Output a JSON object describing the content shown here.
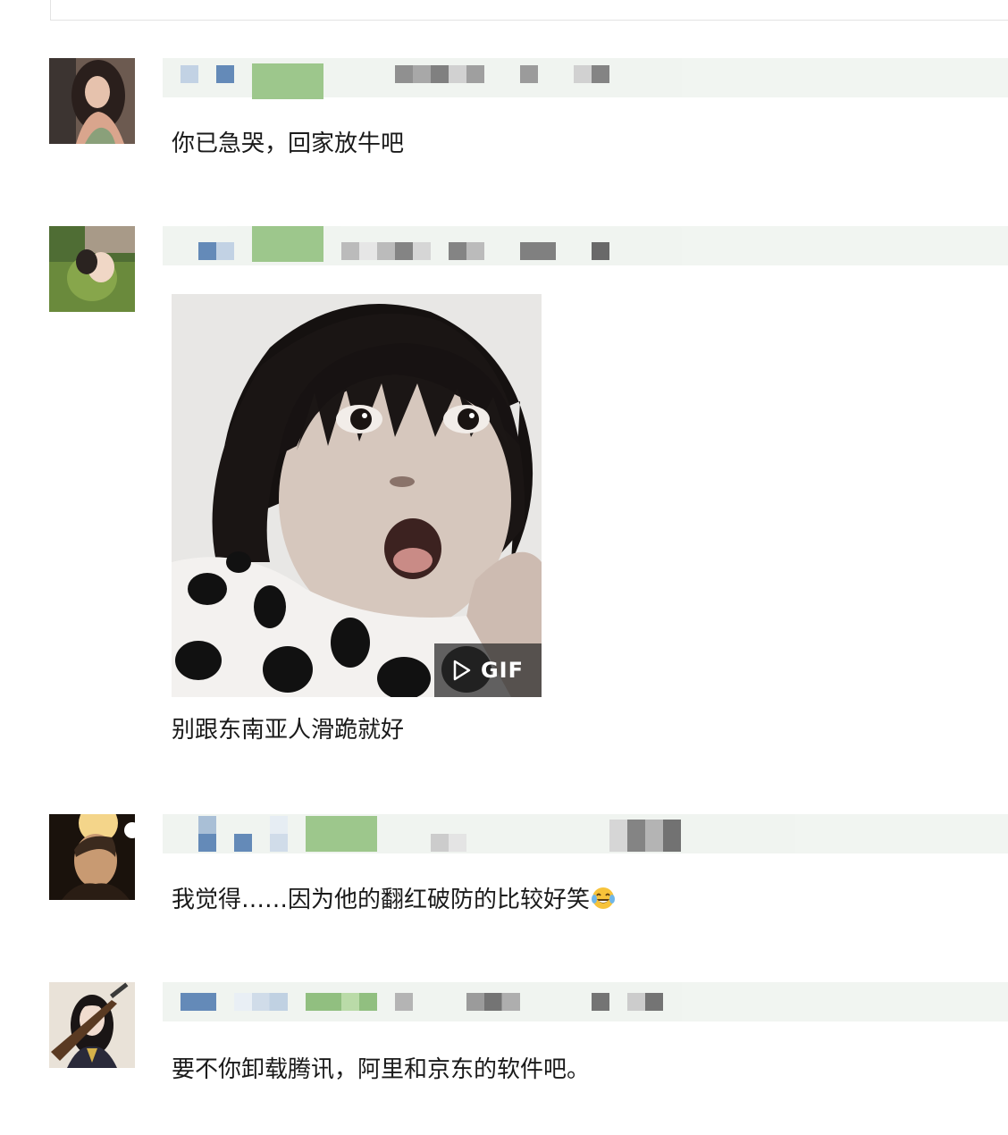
{
  "comments": [
    {
      "text": "你已急哭，回家放牛吧",
      "avatar_icon": "avatar-woman-icon",
      "has_image": false
    },
    {
      "text": "别跟东南亚人滑跪就好",
      "avatar_icon": "avatar-girl-icon",
      "has_image": true,
      "image_badge": "GIF",
      "image_icon": "surprised-child-gif-image"
    },
    {
      "text": "我觉得……因为他的翻红破防的比较好笑",
      "avatar_icon": "avatar-man-icon",
      "has_image": false,
      "emoji": "😂"
    },
    {
      "text": "要不你卸载腾讯，阿里和京东的软件吧。",
      "avatar_icon": "avatar-girl-gun-icon",
      "has_image": false
    }
  ],
  "colors": {
    "band": "#eef3ee",
    "mosaic_blue": "#4a76ac",
    "mosaic_green": "#8dbe78",
    "mosaic_gray": "#7a7a7a",
    "badge_bg": "#2b2b2b"
  }
}
